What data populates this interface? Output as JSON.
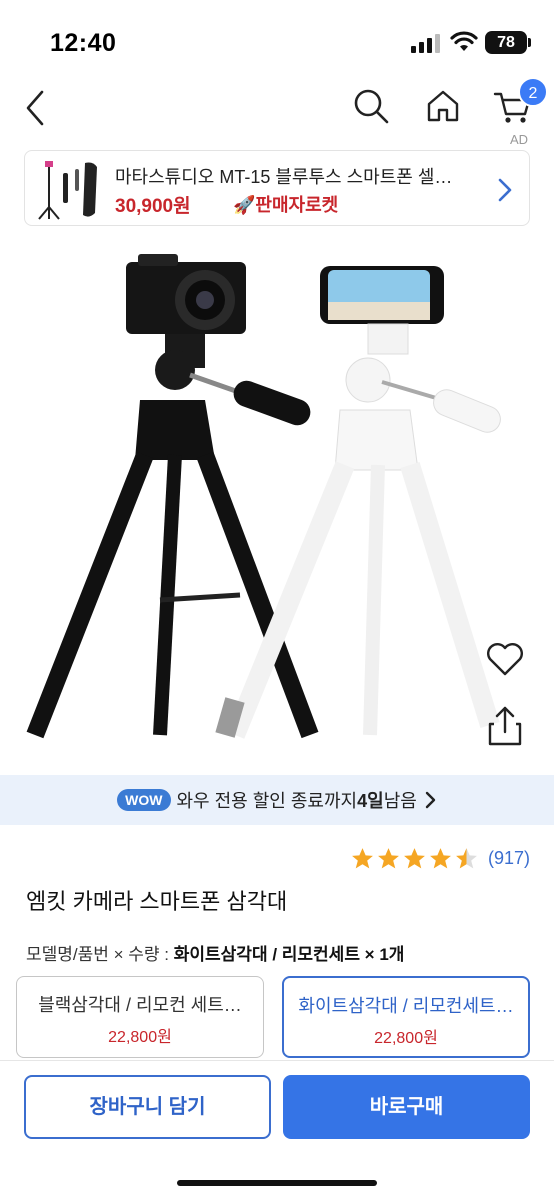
{
  "status_bar": {
    "time": "12:40",
    "battery": "78"
  },
  "nav": {
    "cart_badge": "2",
    "ad_label": "AD"
  },
  "ad": {
    "title": "마타스튜디오 MT-15 블루투스 스마트폰 셀…",
    "price": "30,900원",
    "seller_badge": "🚀판매자로켓"
  },
  "wow_banner": {
    "pill": "WOW",
    "text_before": "와우 전용 할인 종료까지 ",
    "days": "4일",
    "text_after": " 남음"
  },
  "rating": {
    "stars": 4.5,
    "count": "(917)"
  },
  "product": {
    "title": "엠킷 카메라 스마트폰 삼각대",
    "option_label": "모델명/품번 × 수량 : ",
    "option_value": "화이트삼각대 / 리모컨세트 × 1개"
  },
  "options": [
    {
      "name": "블랙삼각대 / 리모컨 세트…",
      "price": "22,800원",
      "selected": false
    },
    {
      "name": "화이트삼각대 / 리모컨세트…",
      "price": "22,800원",
      "selected": true
    }
  ],
  "actions": {
    "add_to_cart": "장바구니 담기",
    "buy_now": "바로구매"
  },
  "colors": {
    "accent": "#3574e6",
    "price_red": "#c8262c",
    "wow_bg": "#eaf1fb",
    "star": "#f5a623"
  },
  "icons": [
    "back-icon",
    "search-icon",
    "home-icon",
    "cart-icon",
    "chevron-right-icon",
    "heart-icon",
    "share-icon",
    "star-icon"
  ]
}
